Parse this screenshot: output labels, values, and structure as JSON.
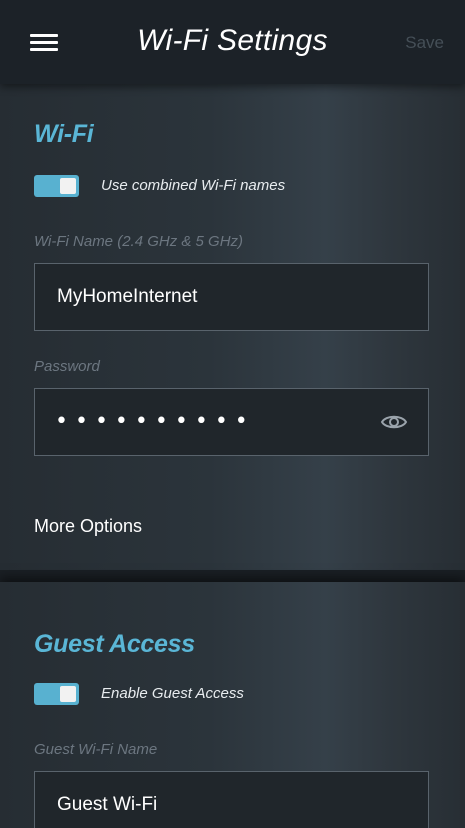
{
  "header": {
    "title": "Wi-Fi Settings",
    "save_label": "Save"
  },
  "wifi": {
    "section_title": "Wi-Fi",
    "combined_toggle": {
      "label": "Use combined Wi-Fi names",
      "on": true
    },
    "name_field": {
      "label": "Wi-Fi Name (2.4 GHz & 5 GHz)",
      "value": "MyHomeInternet"
    },
    "password_field": {
      "label": "Password",
      "masked_value": "••••••••••"
    },
    "more_options_label": "More Options"
  },
  "guest": {
    "section_title": "Guest Access",
    "enable_toggle": {
      "label": "Enable Guest Access",
      "on": true
    },
    "name_field": {
      "label": "Guest Wi-Fi Name",
      "value": "Guest Wi-Fi"
    }
  },
  "colors": {
    "accent": "#5ab6d6",
    "toggle_on": "#58b1d0",
    "save_disabled": "#454f57"
  },
  "icons": {
    "menu": "hamburger-menu-icon",
    "password_visibility": "eye-icon"
  }
}
